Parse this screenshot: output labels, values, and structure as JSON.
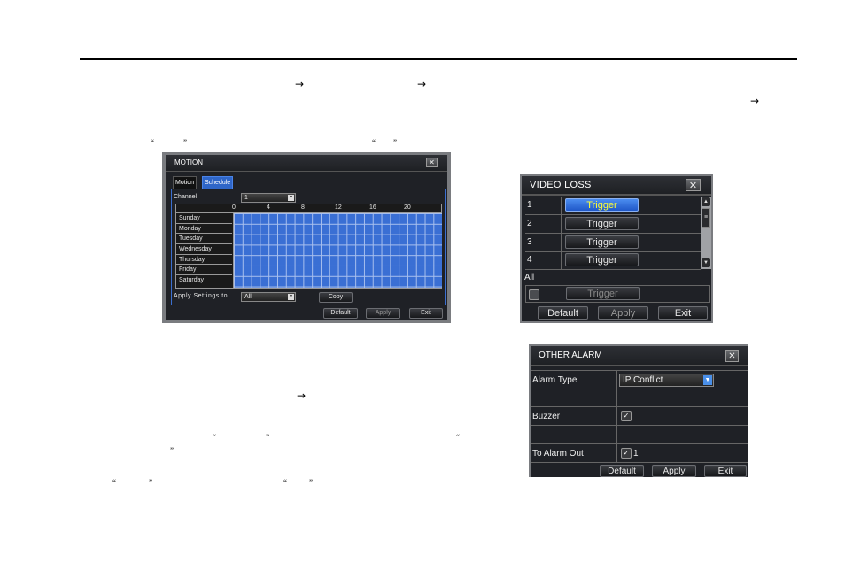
{
  "document": {
    "arrow_glyph": "→",
    "open_quote": "“",
    "close_quote": "”"
  },
  "motion_dialog": {
    "title": "MOTION",
    "close_icon": "✕",
    "tabs": [
      {
        "label": "Motion",
        "active": false
      },
      {
        "label": "Schedule",
        "active": true
      }
    ],
    "channel_label": "Channel",
    "channel_value": "1",
    "hour_ticks": [
      "0",
      "4",
      "8",
      "12",
      "16",
      "20"
    ],
    "days": [
      "Sunday",
      "Monday",
      "Tuesday",
      "Wednesday",
      "Thursday",
      "Friday",
      "Saturday"
    ],
    "schedule_all_selected": true,
    "apply_settings_label": "Apply Settings to",
    "apply_settings_value": "All",
    "copy_label": "Copy",
    "default_label": "Default",
    "apply_label": "Apply",
    "exit_label": "Exit"
  },
  "video_loss_dialog": {
    "title": "VIDEO LOSS",
    "close_icon": "✕",
    "rows": [
      {
        "num": "1",
        "trigger": "Trigger",
        "active": true
      },
      {
        "num": "2",
        "trigger": "Trigger",
        "active": false
      },
      {
        "num": "3",
        "trigger": "Trigger",
        "active": false
      },
      {
        "num": "4",
        "trigger": "Trigger",
        "active": false
      }
    ],
    "all_label": "All",
    "all_trigger": "Trigger",
    "all_checked": false,
    "default_label": "Default",
    "apply_label": "Apply",
    "exit_label": "Exit"
  },
  "other_alarm_dialog": {
    "title": "OTHER ALARM",
    "close_icon": "✕",
    "alarm_type_label": "Alarm Type",
    "alarm_type_value": "IP Conflict",
    "buzzer_label": "Buzzer",
    "buzzer_checked": true,
    "alarm_out_label": "To Alarm Out",
    "alarm_out_value": "1",
    "alarm_out_checked": true,
    "check_glyph": "✓",
    "default_label": "Default",
    "apply_label": "Apply",
    "exit_label": "Exit"
  },
  "colors": {
    "accent_blue": "#2f66c8",
    "active_trigger_text": "#ffff33",
    "dialog_bg": "#1f2126"
  }
}
